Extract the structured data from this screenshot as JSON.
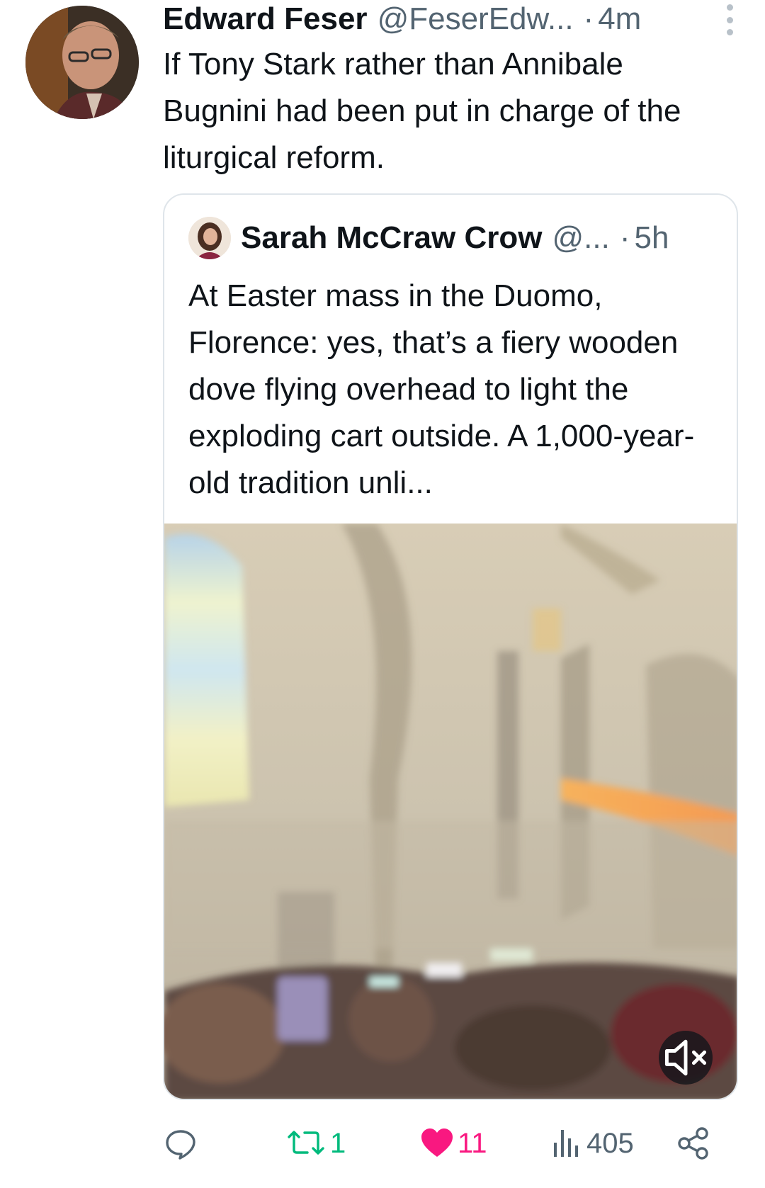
{
  "tweet": {
    "author_name": "Edward Feser",
    "handle": "@FeserEdw...",
    "separator": "·",
    "time": "4m",
    "text": "If Tony Stark rather than Annibale Bugnini had been put in charge of the liturgical reform."
  },
  "quoted_tweet": {
    "author_name": "Sarah McCraw Crow",
    "handle": "@...",
    "separator": "·",
    "time": "5h",
    "text": "At Easter mass in the Duomo, Florence: yes, that’s a fiery wooden dove flying overhead to light the exploding cart outside. A 1,000-year-old tradition unli...",
    "media": {
      "type": "video",
      "mute_icon": "speaker-muted-icon"
    }
  },
  "actions": {
    "reply": {
      "icon": "reply-icon",
      "count": ""
    },
    "retweet": {
      "icon": "retweet-icon",
      "count": "1",
      "color": "#00ba7c"
    },
    "like": {
      "icon": "heart-filled-icon",
      "count": "11",
      "color": "#f91880"
    },
    "views": {
      "icon": "views-icon",
      "count": "405"
    },
    "share": {
      "icon": "share-icon"
    }
  },
  "colors": {
    "text_primary": "#0f1419",
    "text_secondary": "#536471",
    "border": "#dfe5ea"
  }
}
